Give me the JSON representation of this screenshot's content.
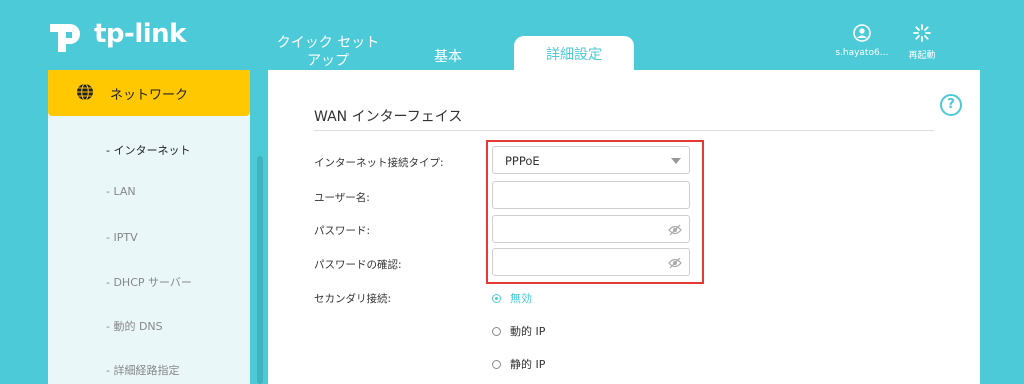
{
  "brand": {
    "name": "tp-link"
  },
  "tabs": {
    "quick_setup": "クイック セット\nアップ",
    "basic": "基本",
    "advanced": "詳細設定"
  },
  "header": {
    "user": "s.hayato6…",
    "reboot": "再起動"
  },
  "sidebar": {
    "section": "ネットワーク",
    "items": [
      {
        "label": "- インターネット",
        "active": true
      },
      {
        "label": "- LAN"
      },
      {
        "label": "- IPTV"
      },
      {
        "label": "- DHCP サーバー"
      },
      {
        "label": "- 動的 DNS"
      },
      {
        "label": "- 詳細経路指定"
      }
    ]
  },
  "main": {
    "title": "WAN インターフェイス",
    "help": "?",
    "form": {
      "connection_type_label": "インターネット接続タイプ:",
      "connection_type_value": "PPPoE",
      "username_label": "ユーザー名:",
      "username_value": "",
      "password_label": "パスワード:",
      "password_value": "",
      "confirm_label": "パスワードの確認:",
      "confirm_value": "",
      "secondary_label": "セカンダリ接続:",
      "secondary_options": [
        {
          "label": "無効",
          "selected": true
        },
        {
          "label": "動的 IP"
        },
        {
          "label": "静的 IP"
        }
      ]
    }
  },
  "colors": {
    "accent": "#4dcad7",
    "active_nav": "#ffc800",
    "highlight": "#e53935"
  }
}
